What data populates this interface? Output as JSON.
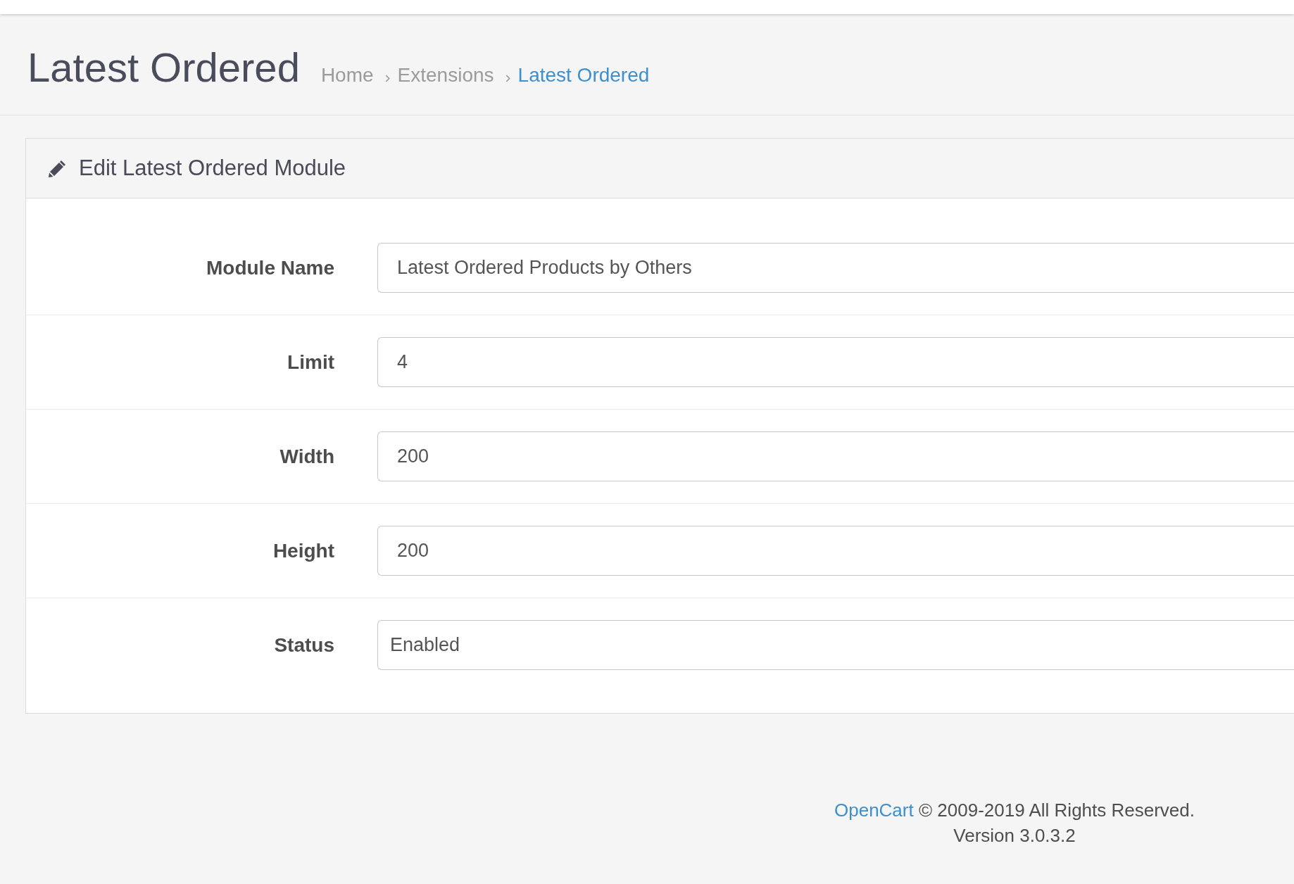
{
  "page_header": {
    "title": "Latest Ordered",
    "breadcrumb": [
      {
        "label": "Home",
        "selected": false
      },
      {
        "label": "Extensions",
        "selected": false
      },
      {
        "label": "Latest Ordered",
        "selected": true
      }
    ]
  },
  "panel": {
    "title": "Edit Latest Ordered Module",
    "fields": [
      {
        "label": "Module Name",
        "kind": "text",
        "value": "Latest Ordered Products by Others"
      },
      {
        "label": "Limit",
        "kind": "text",
        "value": "4"
      },
      {
        "label": "Width",
        "kind": "text",
        "value": "200"
      },
      {
        "label": "Height",
        "kind": "text",
        "value": "200"
      },
      {
        "label": "Status",
        "kind": "select",
        "value": "Enabled"
      }
    ]
  },
  "footer": {
    "link": "OpenCart",
    "copyright": "© 2009-2019 All Rights Reserved.",
    "version": "Version 3.0.3.2"
  }
}
